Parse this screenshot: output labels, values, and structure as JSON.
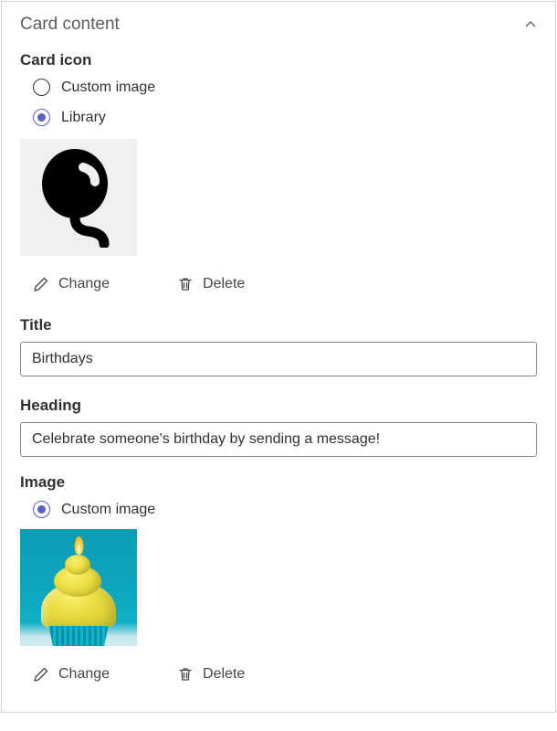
{
  "panel": {
    "title": "Card content"
  },
  "cardIcon": {
    "label": "Card icon",
    "options": {
      "custom": "Custom image",
      "library": "Library"
    },
    "selected": "library",
    "actions": {
      "change": "Change",
      "delete": "Delete"
    },
    "iconName": "balloon-icon"
  },
  "title": {
    "label": "Title",
    "value": "Birthdays"
  },
  "heading": {
    "label": "Heading",
    "value": "Celebrate someone's birthday by sending a message!"
  },
  "image": {
    "label": "Image",
    "options": {
      "custom": "Custom image"
    },
    "selected": "custom",
    "actions": {
      "change": "Change",
      "delete": "Delete"
    },
    "description": "cupcake-with-candle"
  }
}
